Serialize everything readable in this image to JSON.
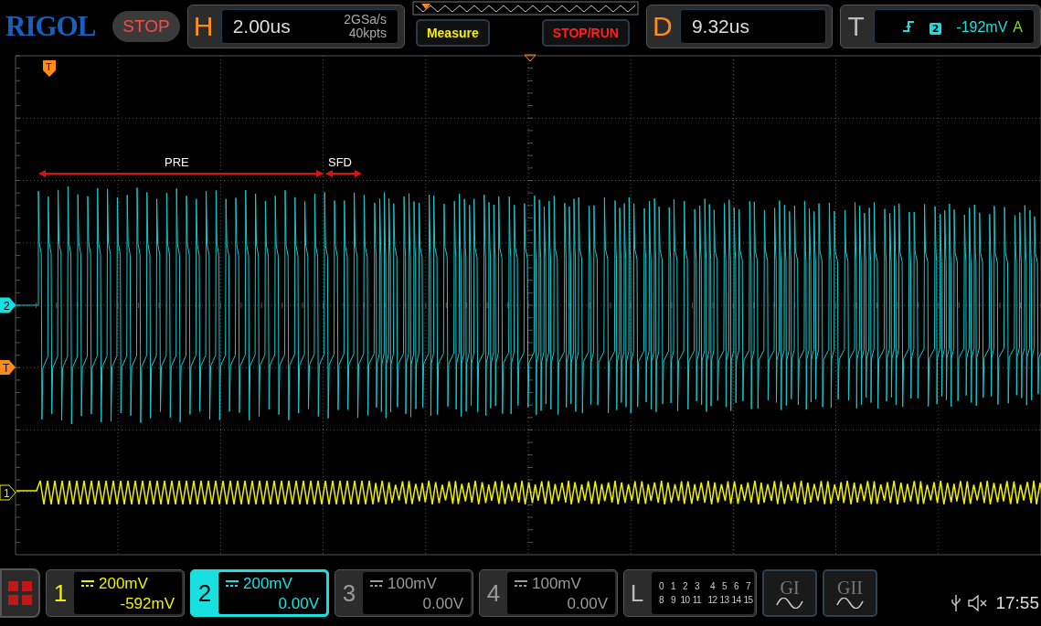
{
  "brand": "RIGOL",
  "run_status": "STOP",
  "horizontal": {
    "label": "H",
    "timebase": "2.00us",
    "sample_rate": "2GSa/s",
    "memory": "40kpts"
  },
  "buttons": [
    {
      "label": "Measure",
      "kind": "measure"
    },
    {
      "label": "STOP/RUN",
      "kind": "run"
    }
  ],
  "delay": {
    "label": "D",
    "value": "9.32us"
  },
  "trigger": {
    "label": "T",
    "source": "2",
    "level": "-192mV",
    "mode": "A"
  },
  "plot": {
    "top_marker": "T",
    "left_markers": [
      {
        "label": "2",
        "kind": "channel",
        "color": "#19e0e0"
      },
      {
        "label": "T",
        "kind": "trigger",
        "color": "#ff8c1a"
      },
      {
        "label": "1",
        "kind": "channel",
        "color": "#f0f000"
      }
    ],
    "annotations": [
      {
        "label": "PRE"
      },
      {
        "label": "SFD"
      }
    ]
  },
  "channels": [
    {
      "label": "1",
      "scale": "200mV",
      "offset": "-592mV",
      "color": "#f0f000",
      "selected": false
    },
    {
      "label": "2",
      "scale": "200mV",
      "offset": "0.00V",
      "color": "#19e0e0",
      "selected": true
    },
    {
      "label": "3",
      "scale": "100mV",
      "offset": "0.00V",
      "color": "#9a9a9a",
      "selected": false
    },
    {
      "label": "4",
      "scale": "100mV",
      "offset": "0.00V",
      "color": "#9a9a9a",
      "selected": false
    }
  ],
  "logic": {
    "label": "L",
    "rows": [
      [
        "0",
        "1",
        "2",
        "3",
        "4",
        "5",
        "6",
        "7"
      ],
      [
        "8",
        "9",
        "10",
        "11",
        "12",
        "13",
        "14",
        "15"
      ]
    ]
  },
  "generators": [
    {
      "label": "GI"
    },
    {
      "label": "GII"
    }
  ],
  "status": {
    "time": "17:55"
  }
}
